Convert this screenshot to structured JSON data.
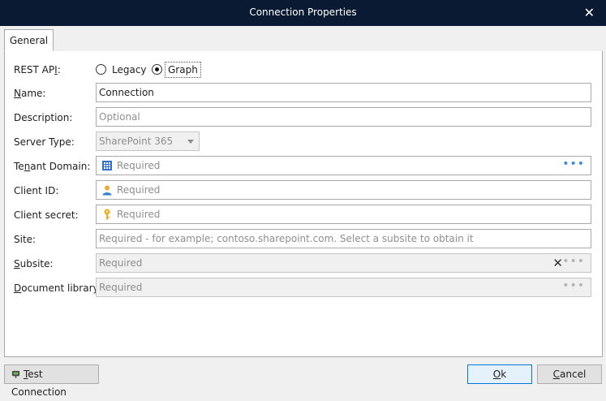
{
  "window": {
    "title": "Connection Properties",
    "close_glyph": "✕"
  },
  "tabs": [
    {
      "label": "General",
      "active": true
    }
  ],
  "form": {
    "rest_api": {
      "label_pre": "REST AP",
      "label_u": "I",
      "label_post": ":",
      "options": [
        "Legacy",
        "Graph"
      ],
      "selected": "Graph"
    },
    "name": {
      "label_pre": "",
      "label_u": "N",
      "label_post": "ame:",
      "value": "Connection"
    },
    "description": {
      "label": "Description:",
      "placeholder": "Optional"
    },
    "server_type": {
      "label": "Server Type:",
      "value": "SharePoint 365"
    },
    "tenant_domain": {
      "label_pre": "Te",
      "label_u": "n",
      "label_post": "ant Domain:",
      "placeholder": "Required",
      "icon": "building-icon"
    },
    "client_id": {
      "label": "Client ID:",
      "placeholder": "Required",
      "icon": "user-icon"
    },
    "client_secret": {
      "label": "Client secret:",
      "placeholder": "Required",
      "icon": "key-icon"
    },
    "site": {
      "label": "Site:",
      "placeholder": "Required - for example; contoso.sharepoint.com. Select a subsite to obtain it"
    },
    "subsite": {
      "label_pre": "",
      "label_u": "S",
      "label_post": "ubsite:",
      "placeholder": "Required"
    },
    "document_library": {
      "label_pre": "",
      "label_u": "D",
      "label_post": "ocument library:",
      "placeholder": "Required"
    },
    "dots_glyph": "•••",
    "clear_glyph": "✕"
  },
  "footer": {
    "test_connection": {
      "pre": "",
      "u": "T",
      "post": "est Connection"
    },
    "ok": {
      "pre": "",
      "u": "O",
      "post": "k"
    },
    "cancel": {
      "pre": "",
      "u": "C",
      "post": "ancel"
    }
  },
  "colors": {
    "titlebar": "#0b1a33",
    "accent": "#3a8de0",
    "ok_border": "#0078d7"
  }
}
